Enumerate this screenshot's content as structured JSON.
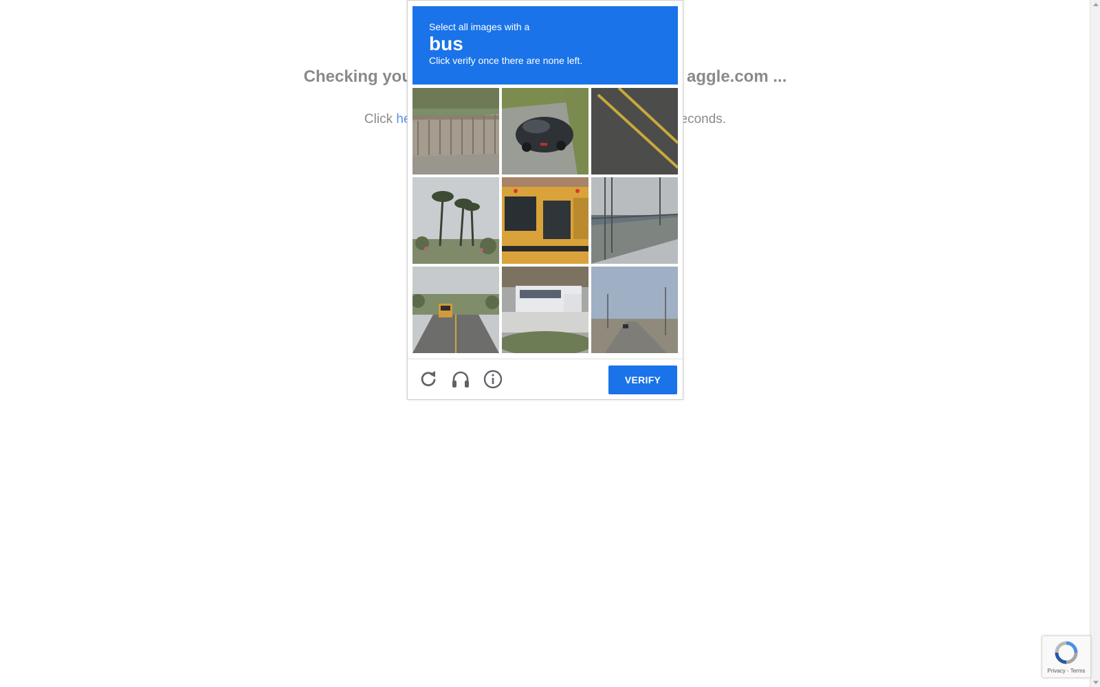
{
  "background": {
    "title": "Checking you … aggle.com ...",
    "title_left": "Checking you",
    "title_right": "aggle.com ...",
    "sub_left": "Click ",
    "sub_link": "he",
    "sub_right": "econds."
  },
  "captcha": {
    "header": {
      "line1": "Select all images with a",
      "target": "bus",
      "line3": "Click verify once there are none left."
    },
    "tiles": [
      {
        "name": "tile-bridge-railing"
      },
      {
        "name": "tile-dark-car"
      },
      {
        "name": "tile-road-lines"
      },
      {
        "name": "tile-palm-trees"
      },
      {
        "name": "tile-school-bus"
      },
      {
        "name": "tile-bridge-power-lines"
      },
      {
        "name": "tile-road-school-bus"
      },
      {
        "name": "tile-city-bus"
      },
      {
        "name": "tile-empty-road"
      }
    ],
    "footer": {
      "reload_icon": "reload-icon",
      "audio_icon": "headphones-icon",
      "info_icon": "info-icon",
      "verify_label": "VERIFY"
    },
    "colors": {
      "accent": "#1a73e8"
    }
  },
  "badge": {
    "links": "Privacy - Terms",
    "privacy": "Privacy",
    "separator": " - ",
    "terms": "Terms"
  }
}
